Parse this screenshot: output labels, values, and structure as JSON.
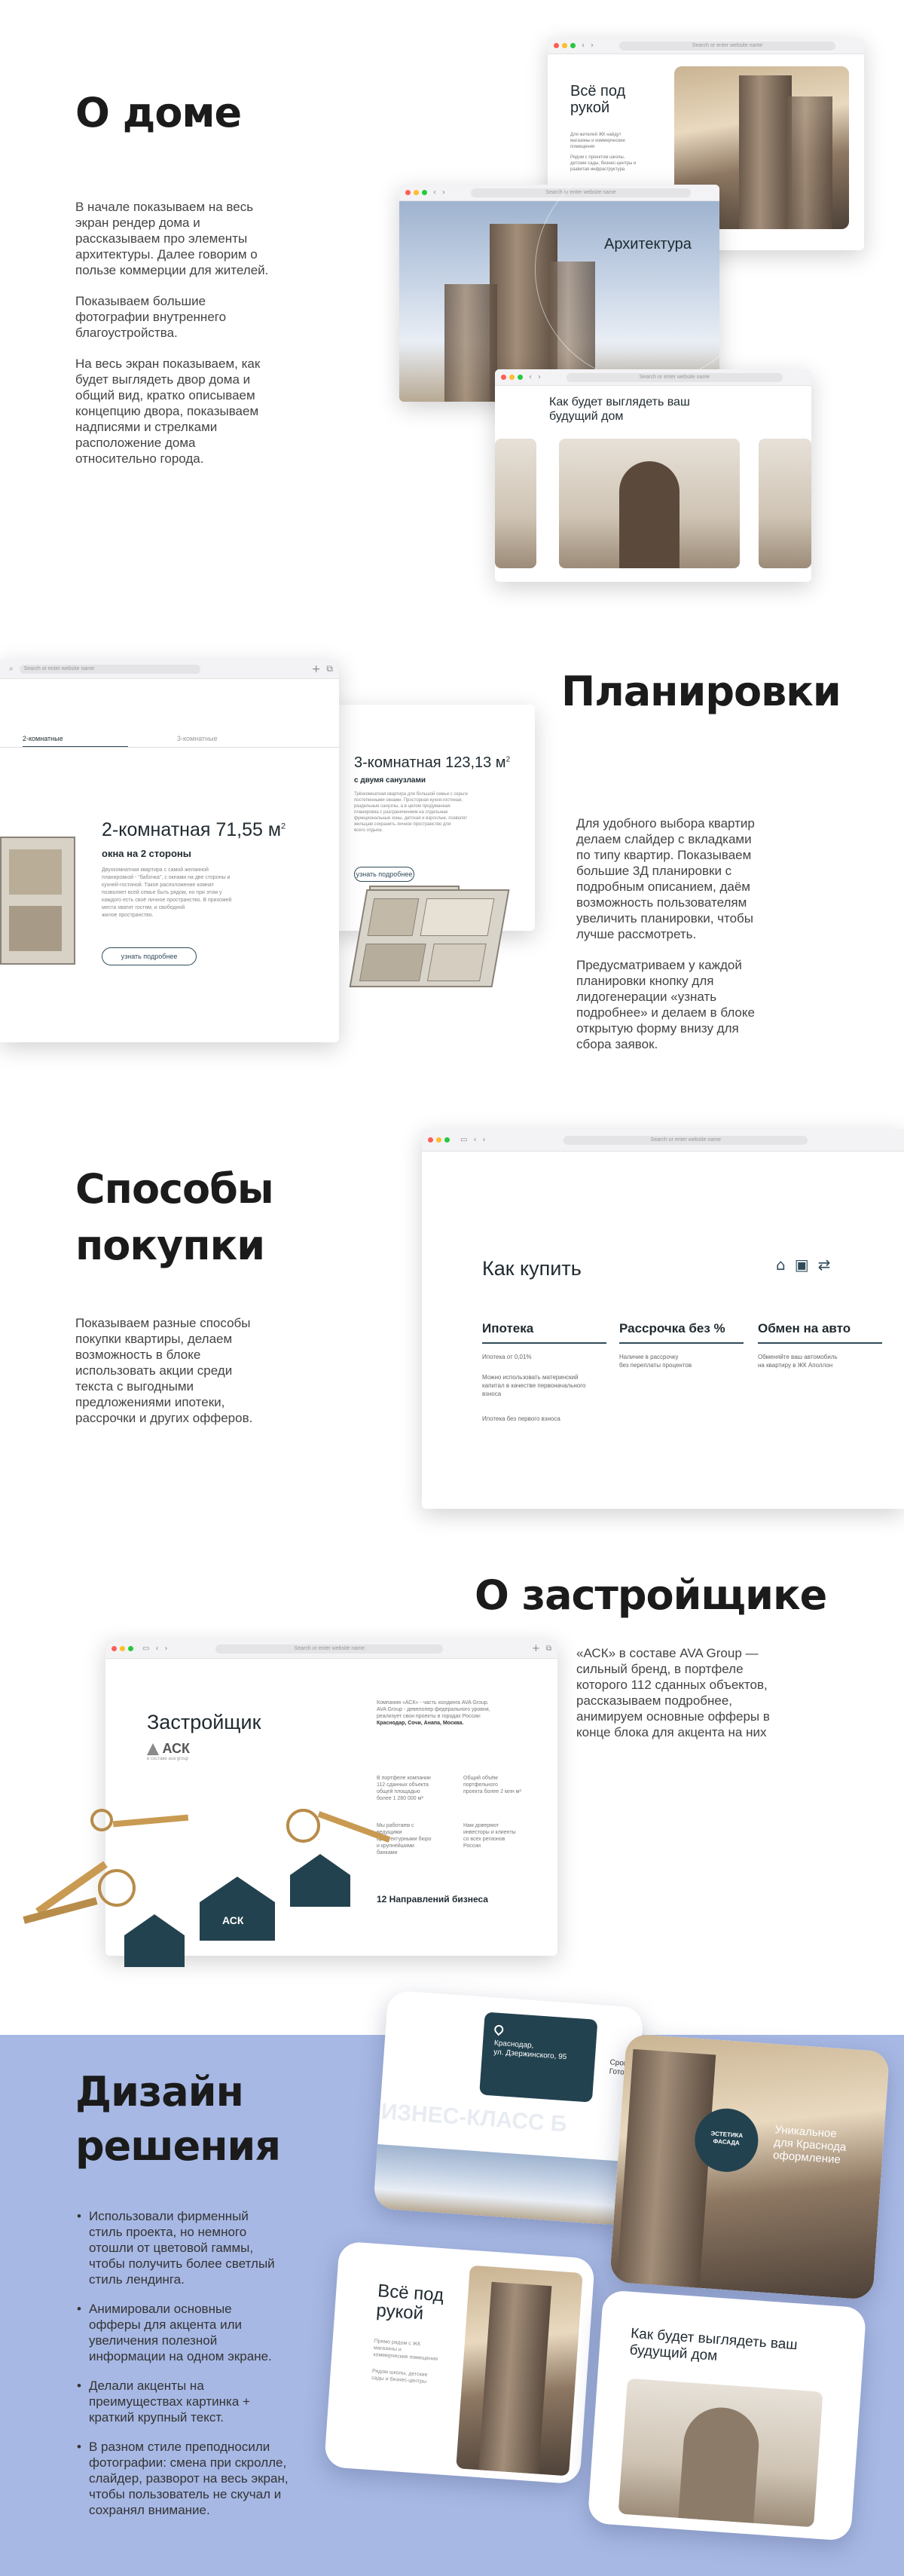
{
  "browser": {
    "address_placeholder": "Search or enter website name"
  },
  "section_about_house": {
    "title": "О доме",
    "paragraphs": [
      "В начале показываем на весь\nэкран рендер дома и\nрассказываем про элементы\nархитектуры. Далее говорим о\nпользе коммерции для жителей.",
      "Показываем большие\nфотографии внутреннего\nблагоустройства.",
      "На весь экран показываем, как\nбудет выглядеть двор дома и\nобщий вид, кратко описываем\nконцепцию двора, показываем\nнадписями и стрелками\nрасположение дома\nотносительно города."
    ],
    "mock1_heading": "Всё под\nрукой",
    "mock1_text": "Для жителей ЖК найдут\nмагазины и коммерческие\nпомещения",
    "mock1_text2": "Рядом с проектом школы,\nдетские сады, бизнес-центры и\nразвитая инфраструктура",
    "mock2_heading": "Архитектура",
    "mock3_heading": "Как будет выглядеть ваш\nбудущий дом"
  },
  "section_layouts": {
    "title": "Планировки",
    "paragraphs": [
      "Для удобного выбора квартир\nделаем слайдер с вкладками\nпо типу квартир. Показываем\nбольшие 3Д планировки с\nподробным описанием, даём\nвозможность пользователям\nувеличить планировки, чтобы\nлучше рассмотреть.",
      "Предусматриваем у каждой\nпланировки кнопку для\nлидогенерации «узнать\nподробнее» и делаем в блоке\nоткрытую форму внизу для\nсбора заявок."
    ],
    "tab_2": "2-комнатные",
    "tab_3": "3-комнатные",
    "flat2_title": "2-комнатная 71,55 м",
    "flat2_sup": "2",
    "flat2_subtitle": "окна на 2 стороны",
    "flat2_desc": "Двухкомнатная квартира с самой желанной\nпланировкой - \"бабочка\", с окнами на две стороны и\nкухней-гостиной. Такое расположение комнат\nпозволяет всей семье быть рядом, но при этом у\nкаждого есть своё личное пространство. В прихожей\nместа хватит гостям, и свободной\nжилое пространство.",
    "flat3_title": "3-комнатная 123,13 м",
    "flat3_sup": "2",
    "flat3_subtitle": "с двумя санузлами",
    "flat3_desc": "Трёхкомнатная квартира для большой семьи с серьги\nпостепенными окнами. Просторная кухня-гостиная,\nраздельные санузлы, а в целом продуманная\nпланировка с разграничением на отдельные\nфункциональные зоны, детская и взрослые, позволят\nжильцам сохранить личное пространство для\nвсего отдыха.",
    "more_button": "узнать подробнее"
  },
  "section_purchase": {
    "title": "Способы\nпокупки",
    "paragraph": "Показываем разные способы\nпокупки квартиры, делаем\nвозможность в блоке\nиспользовать акции среди\nтекста с выгодными\nпредложениями ипотеки,\nрассрочки и других офферов.",
    "mock_heading": "Как купить",
    "columns": [
      {
        "title": "Ипотека",
        "items": [
          "Ипотека от 0,01%",
          "Можно использовать материнский\nкапитал в качестве первоначального\nвзноса",
          "Ипотека без первого взноса"
        ]
      },
      {
        "title": "Рассрочка без %",
        "items": [
          "Наличие в рассрочку\nбез переплаты процентов"
        ]
      },
      {
        "title": "Обмен на авто",
        "items": [
          "Обменяйте ваш автомобиль\nна квартиру в ЖК Аполлон"
        ]
      }
    ]
  },
  "section_developer": {
    "title": "О застройщике",
    "paragraph": "«АСК» в составе AVA Group —\nсильный бренд, в портфеле\nкоторого 112 сданных объектов,\nрассказываем подробнее,\nанимируем основные офферы в\nконце блока для акцента на них",
    "mock_heading": "Застройщик",
    "brand_name": "АСК",
    "brand_sub": "в составе ava group",
    "intro": "Компания «АСК» - часть холдинга AVA Group.\nAVA Group - девелопер федерального уровня,\nреализует свои проекты в городах России:",
    "cities": "Краснодар, Сочи, Анапа, Москва.",
    "stat1": "В портфеле компании\n112 сданных объекта\nобщей площадью\nболее 1 280 000 м²",
    "stat2": "Общий объём\nпортфельного\nпроекта более 2 млн м²",
    "stat3": "Мы работаем с\nведущими\nархитектурными бюро\nи крупнейшими\nбанками",
    "stat4": "Нам доверяют\nинвесторы и клиенты\nсо всех регионов\nРоссии",
    "directions": "12 Направлений бизнеса",
    "keychain_label": "АСК"
  },
  "section_design": {
    "title": "Дизайн\nрешения",
    "bullets": [
      "Использовали фирменный\nстиль проекта, но немного\nотошли от цветовой гаммы,\nчтобы получить более светлый\nстиль лендинга.",
      "Анимировали основные\nофферы для акцента или\nувеличения полезной\nинформации на одном экране.",
      "Делали акценты на\nпреимуществах картинка +\nкраткий крупный текст.",
      "В разном стиле преподносили\nфотографии: смена при скролле,\nслайдер, разворот на весь экран,\nчтобы пользователь не скучал и\nсохранял внимание."
    ],
    "card1_address": "Краснодар,\nул. Дзержинского, 95",
    "card1_deadline": "Срок сд\nГотово",
    "card1_watermark": "БИЗНЕС-КЛАСС  Б",
    "card2_badge": "ЭСТЕТИКА\nФАСАДА",
    "card2_text": "Уникальное\nдля Краснода\nоформление",
    "card3_heading": "Всё под\nрукой",
    "card3_text": "Прямо рядом с ЖК\nмагазины и\nкоммерческие помещения",
    "card3_text2": "Рядом школы, детские\nсады и бизнес-центры",
    "card4_heading": "Как будет выглядеть ваш\nбудущий дом"
  },
  "colors": {
    "accent": "#2f4b5a",
    "design_bg": "#a7b8e4",
    "text": "#1b1b1b"
  }
}
